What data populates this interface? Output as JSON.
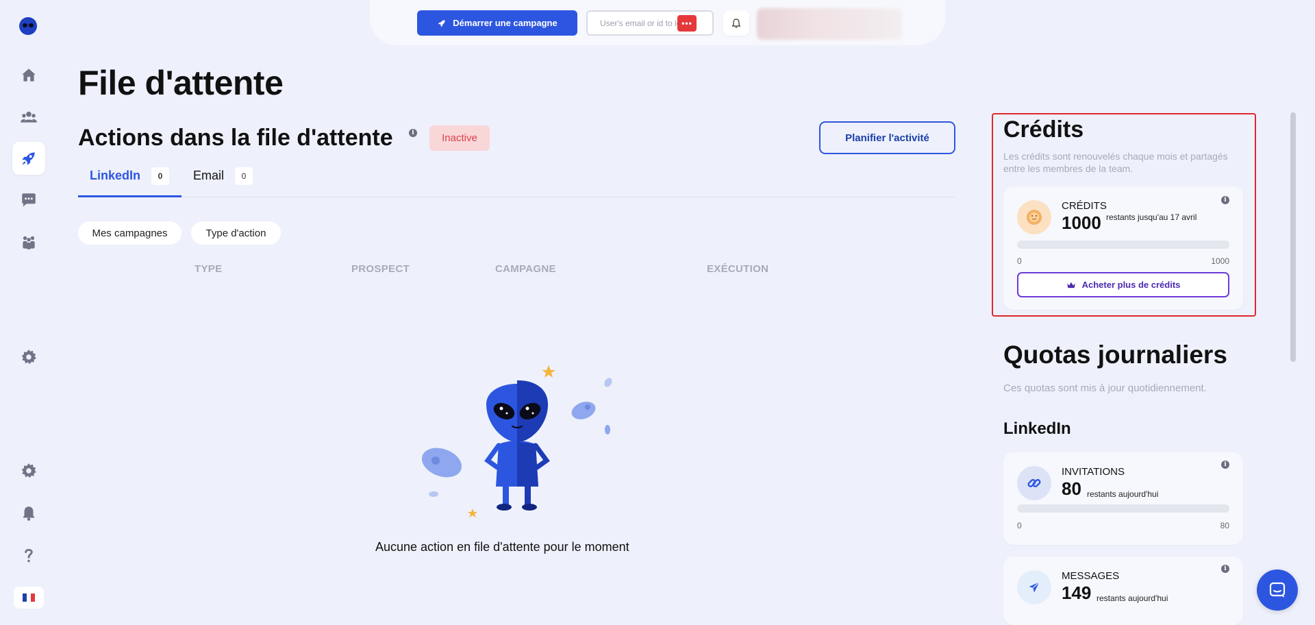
{
  "topbar": {
    "start_campaign_label": "Démarrer une campagne",
    "login_placeholder": "User's email or id to login",
    "password_badge": "•••"
  },
  "main": {
    "page_title": "File d'attente",
    "section_title": "Actions dans la file d'attente",
    "status_badge": "Inactive",
    "plan_button": "Planifier l'activité",
    "tabs": [
      {
        "label": "LinkedIn",
        "count": "0",
        "active": true
      },
      {
        "label": "Email",
        "count": "0",
        "active": false
      }
    ],
    "filters": [
      "Mes campagnes",
      "Type d'action"
    ],
    "columns": [
      "TYPE",
      "PROSPECT",
      "CAMPAGNE",
      "EXÉCUTION"
    ],
    "empty_message": "Aucune action en file d'attente pour le moment"
  },
  "credits": {
    "title": "Crédits",
    "subtitle": "Les crédits sont renouvelés chaque mois et partagés entre les membres de la team.",
    "card": {
      "label": "CRÉDITS",
      "value": "1000",
      "remaining": "restants jusqu'au 17 avril",
      "min": "0",
      "max": "1000",
      "used_fraction": 0,
      "buy_button": "Acheter plus de crédits"
    }
  },
  "quotas": {
    "title": "Quotas journaliers",
    "subtitle": "Ces quotas sont mis à jour quotidiennement.",
    "linkedin_heading": "LinkedIn",
    "items": [
      {
        "label": "INVITATIONS",
        "value": "80",
        "remaining": "restants aujourd'hui",
        "min": "0",
        "max": "80",
        "icon": "link-icon"
      },
      {
        "label": "MESSAGES",
        "value": "149",
        "remaining": "restants aujourd'hui",
        "icon": "send-icon"
      }
    ]
  },
  "colors": {
    "accent": "#2d56e0",
    "inactive_bg": "#f9d6d8",
    "inactive_text": "#d9434c",
    "highlight_border": "#e0262c",
    "buy_purple": "#6c3bd9"
  }
}
